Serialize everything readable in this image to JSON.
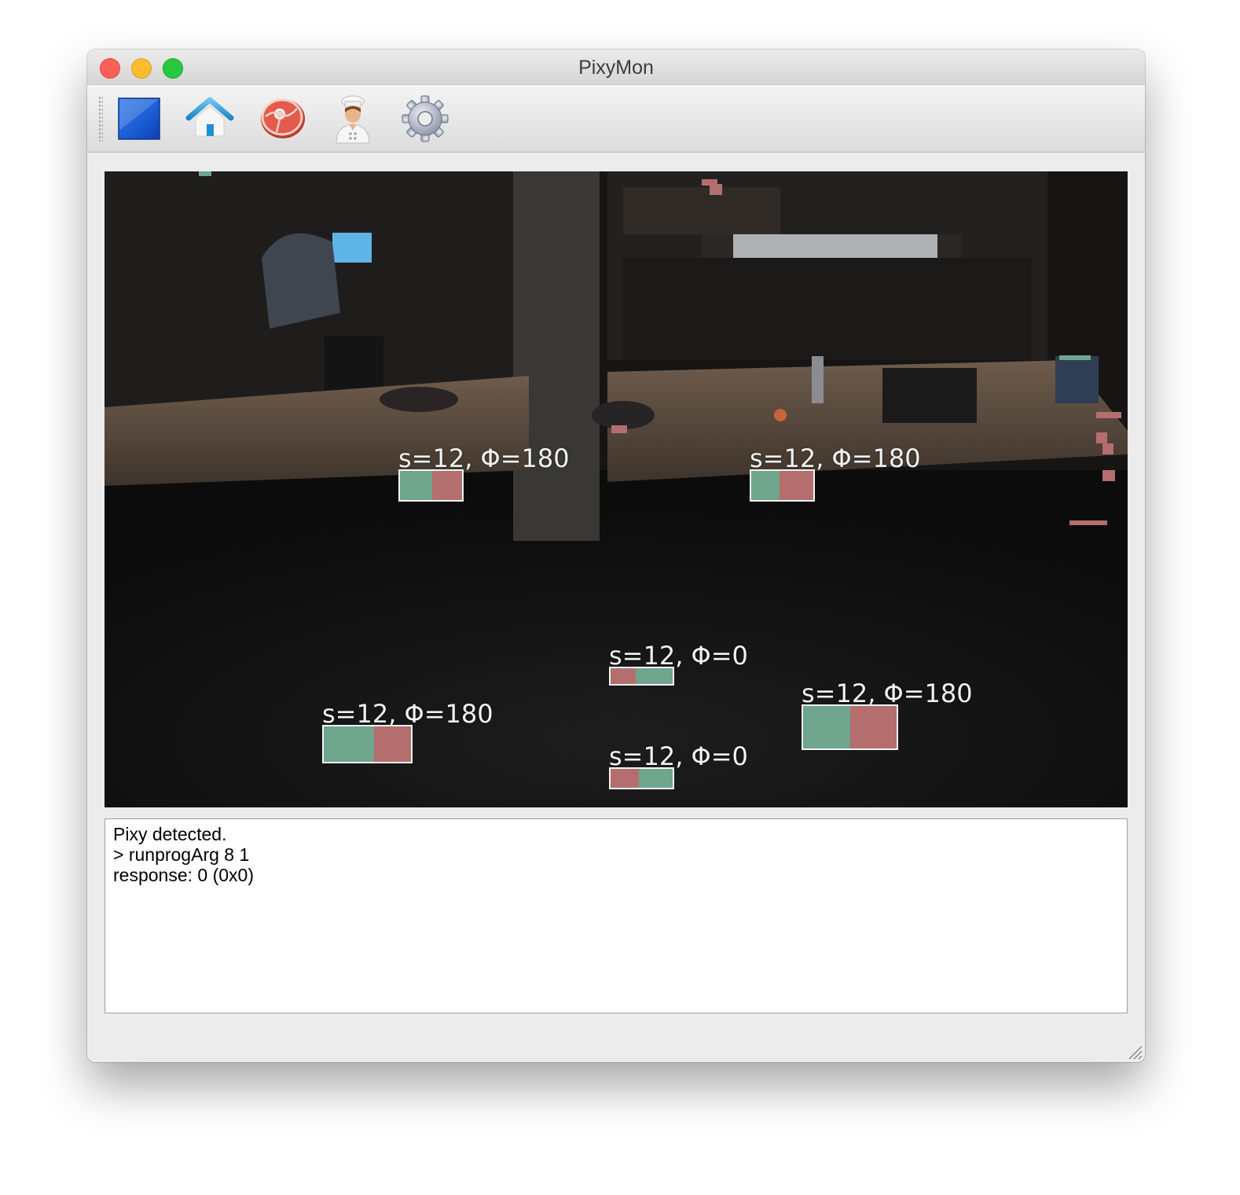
{
  "window": {
    "title": "PixyMon"
  },
  "toolbar": {
    "buttons": [
      {
        "name": "stop-icon",
        "tooltip": ""
      },
      {
        "name": "home-icon",
        "tooltip": ""
      },
      {
        "name": "raw-video-icon",
        "tooltip": ""
      },
      {
        "name": "cook-icon",
        "tooltip": ""
      },
      {
        "name": "gear-icon",
        "tooltip": ""
      }
    ]
  },
  "video": {
    "blocks": [
      {
        "label": "s=12, Φ=180"
      },
      {
        "label": "s=12, Φ=180"
      },
      {
        "label": "s=12, Φ=0"
      },
      {
        "label": "s=12, Φ=180"
      },
      {
        "label": "s=12, Φ=180"
      },
      {
        "label": "s=12, Φ=0"
      }
    ]
  },
  "console": {
    "lines": [
      "Pixy detected.",
      "> runprogArg 8 1",
      "response: 0 (0x0)"
    ]
  },
  "colors": {
    "signature_green": "#6ea58c",
    "signature_red": "#b46e6e",
    "close": "#fc5f57",
    "minimize": "#fdbc2e",
    "maximize": "#28c840"
  }
}
